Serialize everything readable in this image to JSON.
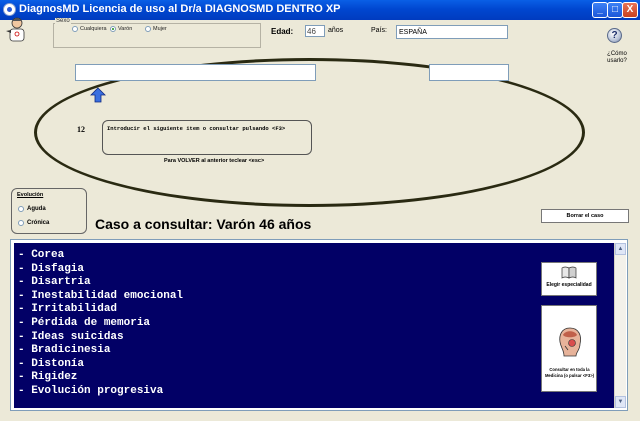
{
  "window": {
    "title": "DiagnosMD Licencia de uso al Dr/a DIAGNOSMD DENTRO XP",
    "minimize": "_",
    "maximize": "□",
    "close": "X"
  },
  "header": {
    "sexo_label": "Sexo",
    "sexo_options": [
      {
        "label": "Cualquiera",
        "selected": false
      },
      {
        "label": "Varón",
        "selected": true
      },
      {
        "label": "Mujer",
        "selected": false
      }
    ],
    "edad_label": "Edad:",
    "edad_value": "46",
    "anos_label": "años",
    "pais_label": "País:",
    "pais_value": "ESPAÑA",
    "help_symbol": "?",
    "help_label": "¿Cómo usarlo?"
  },
  "query": {
    "step_number": "12",
    "instruction": "Introducir el siguiente item o consultar pulsando <F3>",
    "volver": "Para VOLVER al anterior teclear <esc>"
  },
  "evolucion": {
    "title": "Evolución",
    "options": [
      {
        "label": "Aguda",
        "selected": false
      },
      {
        "label": "Crónica",
        "selected": false
      }
    ]
  },
  "case": {
    "title": "Caso a consultar: Varón 46 años",
    "borrar_label": "Borrar el caso"
  },
  "symptoms": [
    "- Corea",
    "- Disfagia",
    "- Disartria",
    "- Inestabilidad emocional",
    "- Irritabilidad",
    "- Pérdida de memoria",
    "- Ideas suicidas",
    "- Bradicinesia",
    "- Distonía",
    "- Rigidez",
    "- Evolución progresiva"
  ],
  "actions": {
    "especialidad_label": "Elegir especialidad",
    "consultar_label": "Consultar en toda la Medicina (o pulsar <F3>)"
  }
}
